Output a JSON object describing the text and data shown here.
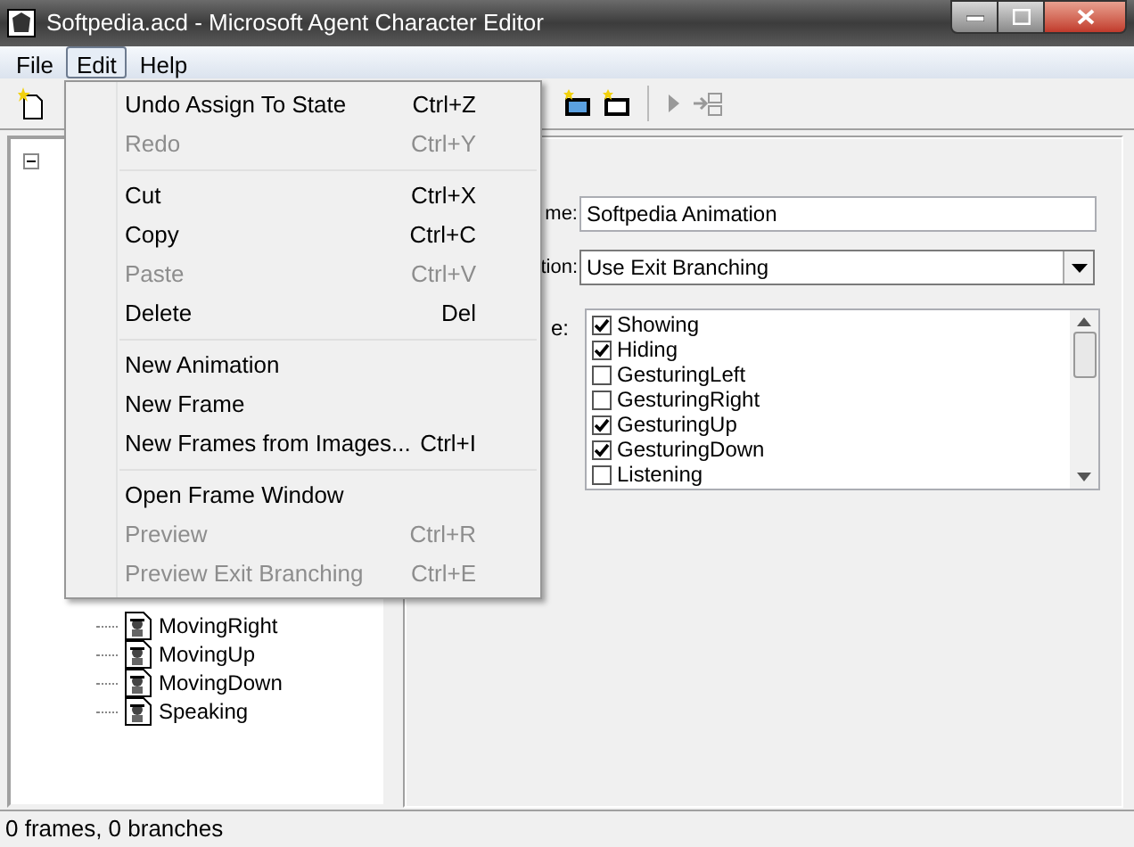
{
  "window": {
    "title": "Softpedia.acd - Microsoft Agent Character Editor"
  },
  "menu_bar": [
    {
      "label": "File",
      "selected": false
    },
    {
      "label": "Edit",
      "selected": true
    },
    {
      "label": "Help",
      "selected": false
    }
  ],
  "edit_menu": [
    {
      "kind": "item",
      "label": "Undo Assign To State",
      "shortcut": "Ctrl+Z",
      "disabled": false
    },
    {
      "kind": "item",
      "label": "Redo",
      "shortcut": "Ctrl+Y",
      "disabled": true
    },
    {
      "kind": "separator"
    },
    {
      "kind": "item",
      "label": "Cut",
      "shortcut": "Ctrl+X",
      "disabled": false
    },
    {
      "kind": "item",
      "label": "Copy",
      "shortcut": "Ctrl+C",
      "disabled": false
    },
    {
      "kind": "item",
      "label": "Paste",
      "shortcut": "Ctrl+V",
      "disabled": true
    },
    {
      "kind": "item",
      "label": "Delete",
      "shortcut": "Del",
      "disabled": false
    },
    {
      "kind": "separator"
    },
    {
      "kind": "item",
      "label": "New Animation",
      "disabled": false
    },
    {
      "kind": "item",
      "label": "New Frame",
      "disabled": false
    },
    {
      "kind": "item",
      "label": "New Frames from Images...",
      "shortcut": "Ctrl+I",
      "disabled": false
    },
    {
      "kind": "separator"
    },
    {
      "kind": "item",
      "label": "Open Frame Window",
      "disabled": false
    },
    {
      "kind": "item",
      "label": "Preview",
      "shortcut": "Ctrl+R",
      "disabled": true
    },
    {
      "kind": "item",
      "label": "Preview Exit Branching",
      "shortcut": "Ctrl+E",
      "disabled": true
    }
  ],
  "tree": {
    "expanded": true,
    "children": [
      {
        "label": "MovingRight"
      },
      {
        "label": "MovingUp"
      },
      {
        "label": "MovingDown"
      },
      {
        "label": "Speaking"
      }
    ]
  },
  "properties": {
    "name_label": "me:",
    "name_value": "Softpedia Animation",
    "return_label": "tion:",
    "return_value": "Use Exit Branching",
    "state_label": "e:",
    "states": [
      {
        "label": "Showing",
        "checked": true
      },
      {
        "label": "Hiding",
        "checked": true
      },
      {
        "label": "GesturingLeft",
        "checked": false
      },
      {
        "label": "GesturingRight",
        "checked": false
      },
      {
        "label": "GesturingUp",
        "checked": true
      },
      {
        "label": "GesturingDown",
        "checked": true
      },
      {
        "label": "Listening",
        "checked": false
      }
    ]
  },
  "status_bar": "0 frames, 0 branches"
}
